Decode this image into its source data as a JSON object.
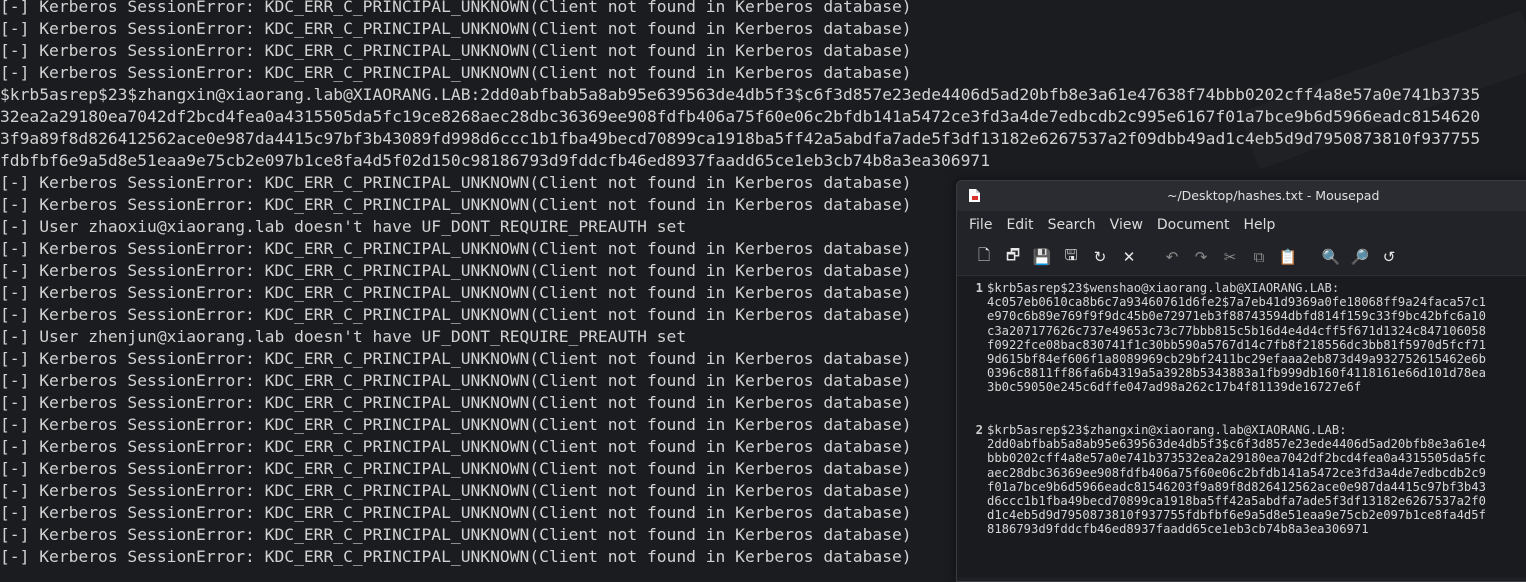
{
  "terminal": {
    "lines": [
      "[-] Kerberos SessionError: KDC_ERR_C_PRINCIPAL_UNKNOWN(Client not found in Kerberos database)",
      "[-] Kerberos SessionError: KDC_ERR_C_PRINCIPAL_UNKNOWN(Client not found in Kerberos database)",
      "[-] Kerberos SessionError: KDC_ERR_C_PRINCIPAL_UNKNOWN(Client not found in Kerberos database)",
      "[-] Kerberos SessionError: KDC_ERR_C_PRINCIPAL_UNKNOWN(Client not found in Kerberos database)",
      "$krb5asrep$23$zhangxin@xiaorang.lab@XIAORANG.LAB:2dd0abfbab5a8ab95e639563de4db5f3$c6f3d857e23ede4406d5ad20bfb8e3a61e47638f74bbb0202cff4a8e57a0e741b3735",
      "32ea2a29180ea7042df2bcd4fea0a4315505da5fc19ce8268aec28dbc36369ee908fdfb406a75f60e06c2bfdb141a5472ce3fd3a4de7edbcdb2c995e6167f01a7bce9b6d5966eadc8154620",
      "3f9a89f8d826412562ace0e987da4415c97bf3b43089fd998d6ccc1b1fba49becd70899ca1918ba5ff42a5abdfa7ade5f3df13182e6267537a2f09dbb49ad1c4eb5d9d7950873810f937755",
      "fdbfbf6e9a5d8e51eaa9e75cb2e097b1ce8fa4d5f02d150c98186793d9fddcfb46ed8937faadd65ce1eb3cb74b8a3ea306971",
      "[-] Kerberos SessionError: KDC_ERR_C_PRINCIPAL_UNKNOWN(Client not found in Kerberos database)",
      "[-] Kerberos SessionError: KDC_ERR_C_PRINCIPAL_UNKNOWN(Client not found in Kerberos database)",
      "[-] User zhaoxiu@xiaorang.lab doesn't have UF_DONT_REQUIRE_PREAUTH set",
      "[-] Kerberos SessionError: KDC_ERR_C_PRINCIPAL_UNKNOWN(Client not found in Kerberos database)",
      "[-] Kerberos SessionError: KDC_ERR_C_PRINCIPAL_UNKNOWN(Client not found in Kerberos database)",
      "[-] Kerberos SessionError: KDC_ERR_C_PRINCIPAL_UNKNOWN(Client not found in Kerberos database)",
      "[-] Kerberos SessionError: KDC_ERR_C_PRINCIPAL_UNKNOWN(Client not found in Kerberos database)",
      "[-] User zhenjun@xiaorang.lab doesn't have UF_DONT_REQUIRE_PREAUTH set",
      "[-] Kerberos SessionError: KDC_ERR_C_PRINCIPAL_UNKNOWN(Client not found in Kerberos database)",
      "[-] Kerberos SessionError: KDC_ERR_C_PRINCIPAL_UNKNOWN(Client not found in Kerberos database)",
      "[-] Kerberos SessionError: KDC_ERR_C_PRINCIPAL_UNKNOWN(Client not found in Kerberos database)",
      "[-] Kerberos SessionError: KDC_ERR_C_PRINCIPAL_UNKNOWN(Client not found in Kerberos database)",
      "[-] Kerberos SessionError: KDC_ERR_C_PRINCIPAL_UNKNOWN(Client not found in Kerberos database)",
      "[-] Kerberos SessionError: KDC_ERR_C_PRINCIPAL_UNKNOWN(Client not found in Kerberos database)",
      "[-] Kerberos SessionError: KDC_ERR_C_PRINCIPAL_UNKNOWN(Client not found in Kerberos database)",
      "[-] Kerberos SessionError: KDC_ERR_C_PRINCIPAL_UNKNOWN(Client not found in Kerberos database)",
      "[-] Kerberos SessionError: KDC_ERR_C_PRINCIPAL_UNKNOWN(Client not found in Kerberos database)",
      "[-] Kerberos SessionError: KDC_ERR_C_PRINCIPAL_UNKNOWN(Client not found in Kerberos database)"
    ]
  },
  "mousepad": {
    "title": "~/Desktop/hashes.txt - Mousepad",
    "menu": [
      "File",
      "Edit",
      "Search",
      "View",
      "Document",
      "Help"
    ],
    "toolbar": [
      {
        "name": "new-document-icon",
        "glyph": "🗋",
        "enabled": true
      },
      {
        "name": "new-window-icon",
        "glyph": "🗗",
        "enabled": true
      },
      {
        "name": "save-icon",
        "glyph": "💾",
        "enabled": false
      },
      {
        "name": "save-as-icon",
        "glyph": "🖫",
        "enabled": true
      },
      {
        "name": "reload-icon",
        "glyph": "↻",
        "enabled": true
      },
      {
        "name": "close-icon",
        "glyph": "✕",
        "enabled": true
      },
      {
        "name": "undo-icon",
        "glyph": "↶",
        "enabled": false
      },
      {
        "name": "redo-icon",
        "glyph": "↷",
        "enabled": false
      },
      {
        "name": "cut-icon",
        "glyph": "✂",
        "enabled": false
      },
      {
        "name": "copy-icon",
        "glyph": "⧉",
        "enabled": false
      },
      {
        "name": "paste-icon",
        "glyph": "📋",
        "enabled": true
      },
      {
        "name": "find-icon",
        "glyph": "🔍",
        "enabled": true
      },
      {
        "name": "find-replace-icon",
        "glyph": "🔎",
        "enabled": true
      },
      {
        "name": "goto-line-icon",
        "glyph": "↺",
        "enabled": true
      }
    ],
    "line_numbers": [
      "1",
      "2"
    ],
    "lines": [
      [
        "$krb5asrep$23$wenshao@xiaorang.lab@XIAORANG.LAB:",
        "4c057eb0610ca8b6c7a93460761d6fe2$7a7eb41d9369a0fe18068ff9a24faca57c1",
        "e970c6b89e769f9f9dc45b0e72971eb3f88743594dbfd814f159c33f9bc42bfc6a10",
        "c3a207177626c737e49653c73c77bbb815c5b16d4e4d4cff5f671d1324c847106058",
        "f0922fce08bac830741f1c30bb590a5767d14c7fb8f218556dc3bb81f5970d5fcf71",
        "9d615bf84ef606f1a8089969cb29bf2411bc29efaaa2eb873d49a932752615462e6b",
        "0396c8811ff86fa6b4319a5a3928b5343883a1fb999db160f4118161e66d101d78ea",
        "3b0c59050e245c6dffe047ad98a262c17b4f81139de16727e6f"
      ],
      [
        "$krb5asrep$23$zhangxin@xiaorang.lab@XIAORANG.LAB:",
        "2dd0abfbab5a8ab95e639563de4db5f3$c6f3d857e23ede4406d5ad20bfb8e3a61e4",
        "bbb0202cff4a8e57a0e741b373532ea2a29180ea7042df2bcd4fea0a4315505da5fc",
        "aec28dbc36369ee908fdfb406a75f60e06c2bfdb141a5472ce3fd3a4de7edbcdb2c9",
        "f01a7bce9b6d5966eadc81546203f9a89f8d826412562ace0e987da4415c97bf3b43",
        "d6ccc1b1fba49becd70899ca1918ba5ff42a5abdfa7ade5f3df13182e6267537a2f0",
        "d1c4eb5d9d7950873810f937755fdbfbf6e9a5d8e51eaa9e75cb2e097b1ce8fa4d5f",
        "8186793d9fddcfb46ed8937faadd65ce1eb3cb74b8a3ea306971"
      ]
    ]
  }
}
